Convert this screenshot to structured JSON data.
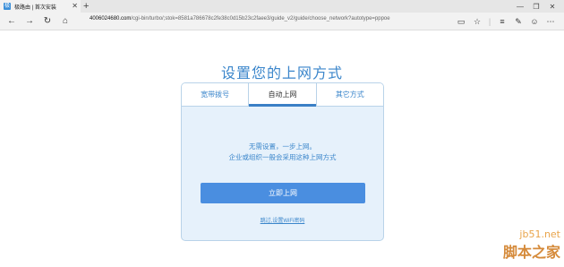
{
  "browser": {
    "tab_title": "极路由 | 首次安装",
    "tab_favicon_glyph": "极",
    "tab_close_glyph": "✕",
    "new_tab_glyph": "+",
    "window_controls": [
      "—",
      "❐",
      "✕"
    ],
    "address_host": "4006024680.com",
    "address_path": "/cgi-bin/turbo/;stok=8581a786678c2fe38c0d15b23c2faee3/guide_v2/guide/choose_network?autotype=pppoe",
    "nav_icons": [
      "back-icon",
      "forward-icon",
      "refresh-icon",
      "home-icon"
    ],
    "nav_glyphs": [
      "←",
      "→",
      "↻",
      "⌂"
    ],
    "tool_glyphs": [
      "▭",
      "☆",
      "|",
      "≡",
      "✎",
      "☺",
      "⋯"
    ]
  },
  "page": {
    "title": "设置您的上网方式",
    "tabs": [
      {
        "label": "宽带拨号",
        "active": false
      },
      {
        "label": "自动上网",
        "active": true
      },
      {
        "label": "其它方式",
        "active": false
      }
    ],
    "desc_line1": "无需设置，一步上网。",
    "desc_line2": "企业或组织一般会采用这种上网方式",
    "connect_button": "立即上网",
    "skip_link": "跳过,设置WiFi密码"
  },
  "watermark": {
    "url": "jb51.net",
    "text": "脚本之家"
  },
  "colors": {
    "accent": "#3b86cb",
    "button": "#4a8ee0",
    "panel_bg": "#e6f1fb"
  }
}
